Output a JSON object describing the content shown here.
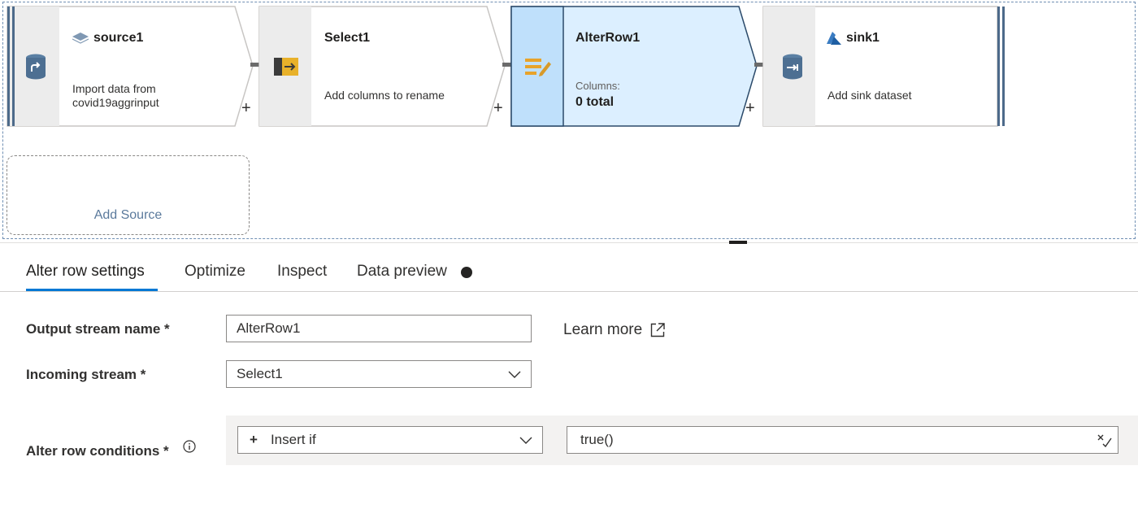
{
  "pipeline": {
    "nodes": [
      {
        "title": "source1",
        "desc_line1": "Import data from",
        "desc_line2": "covid19aggrinput",
        "icon": "database-source-icon"
      },
      {
        "title": "Select1",
        "desc": "Add columns to rename",
        "icon": "select-transform-icon"
      },
      {
        "title": "AlterRow1",
        "columns_label": "Columns:",
        "columns_value": "0 total",
        "icon": "alter-row-icon"
      },
      {
        "title": "sink1",
        "desc": "Add sink dataset",
        "icon": "database-sink-icon"
      }
    ],
    "add_node_label": "+",
    "add_source_label": "Add Source"
  },
  "tabs": [
    {
      "label": "Alter row settings",
      "active": true
    },
    {
      "label": "Optimize"
    },
    {
      "label": "Inspect"
    },
    {
      "label": "Data preview"
    }
  ],
  "form": {
    "output_stream_label": "Output stream name *",
    "output_stream_value": "AlterRow1",
    "learn_more_label": "Learn more",
    "incoming_stream_label": "Incoming stream *",
    "incoming_stream_value": "Select1",
    "conditions_label": "Alter row conditions *",
    "condition_type": "Insert if",
    "condition_add_glyph": "+",
    "condition_expression": "true()"
  },
  "colors": {
    "selected_node_fill": "#dcefff",
    "node_border": "#c8c6c4",
    "accent": "#0078d4",
    "rail": "#4d6a8a"
  }
}
